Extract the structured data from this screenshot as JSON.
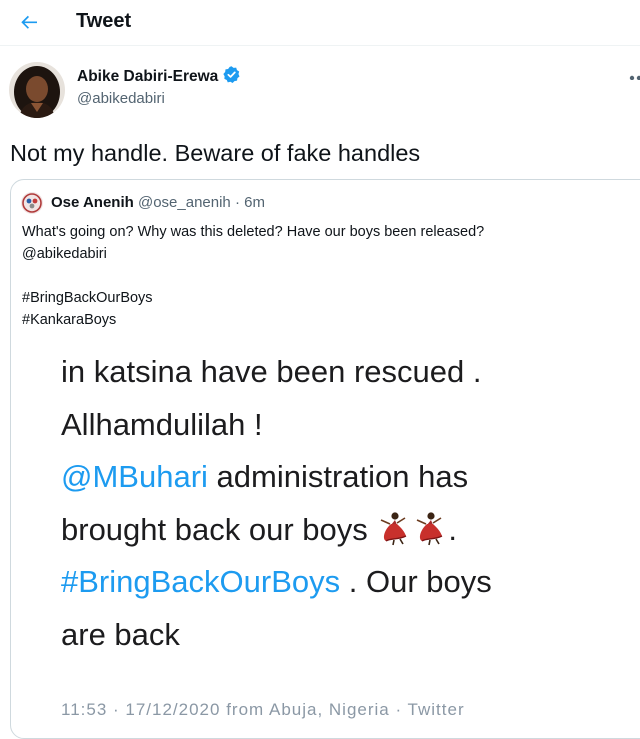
{
  "header": {
    "title": "Tweet",
    "back_icon": "arrow-left-icon",
    "accent": "#1d9bf0"
  },
  "tweet": {
    "author": {
      "name": "Abike Dabiri-Erewa",
      "handle": "@abikedabiri",
      "verified": true
    },
    "text": "Not my handle. Beware of fake handles"
  },
  "quoted_tweet": {
    "author_name": "Ose Anenih",
    "author_handle": "@ose_anenih",
    "separator": " · ",
    "time": "6m",
    "lines": [
      "What's going on? Why was this deleted? Have our boys been released?",
      "@abikedabiri",
      "#BringBackOurBoys",
      "#KankaraBoys"
    ],
    "embedded_screenshot": {
      "line1": "in katsina have been rescued .",
      "line2": "Allhamdulilah !",
      "line3_mention": "@MBuhari",
      "line3_rest": " administration has",
      "line4": "brought back our boys",
      "line4_emoji": "dancer-icon",
      "line4_end": ".",
      "line5_hashtag": "#BringBackOurBoys",
      "line5_rest": " . Our boys",
      "line6": "are back",
      "footer_fragment": "11:53 · 17/12/2020 from Abuja, Nigeria · Twitter"
    }
  }
}
